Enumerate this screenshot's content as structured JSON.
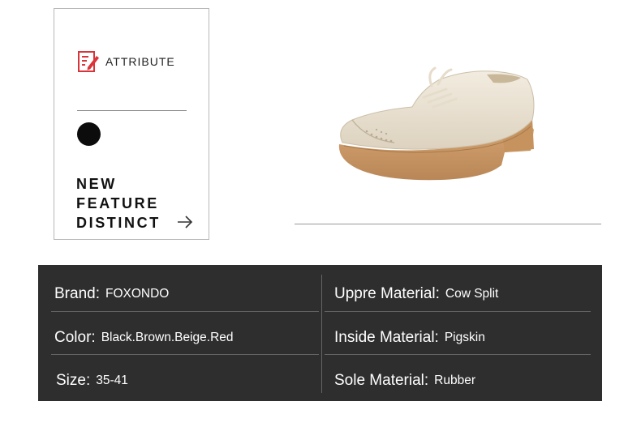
{
  "attribute_card": {
    "icon": "edit-document-icon",
    "title": "ATTRIBUTE",
    "feature_lines": [
      "NEW",
      "FEATURE",
      "DISTINCT"
    ],
    "arrow_icon": "arrow-right-icon"
  },
  "product_image": {
    "subject": "beige brogue oxford shoe"
  },
  "specs": {
    "brand": {
      "label": "Brand:",
      "value": "FOXONDO"
    },
    "upper_material": {
      "label": "Uppre Material:",
      "value": "Cow Split"
    },
    "color": {
      "label": "Color:",
      "value": "Black.Brown.Beige.Red"
    },
    "inside_material": {
      "label": "Inside Material:",
      "value": "Pigskin"
    },
    "size": {
      "label": "Size:",
      "value": "35-41"
    },
    "sole_material": {
      "label": "Sole Material:",
      "value": "Rubber"
    }
  },
  "colors": {
    "table_background": "#2e2e2e",
    "accent_icon": "#d9343a",
    "text_on_dark": "#ffffff"
  }
}
